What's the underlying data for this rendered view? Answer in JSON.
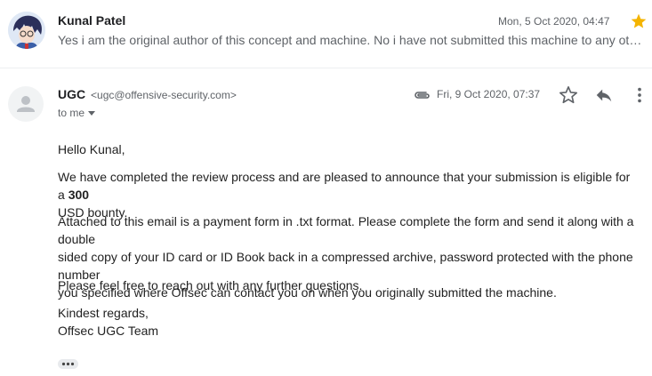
{
  "thread": {
    "collapsed_message": {
      "sender_name": "Kunal Patel",
      "date": "Mon, 5 Oct 2020, 04:47",
      "starred": true,
      "snippet": "Yes i am the original author of this concept and machine. No i have not submitted this machine to any other h..."
    },
    "expanded_message": {
      "sender_name": "UGC",
      "sender_email": "<ugc@offensive-security.com>",
      "to_label": "to me",
      "date": "Fri, 9 Oct 2020, 07:37",
      "has_attachment": true,
      "body": {
        "greeting": "Hello Kunal,",
        "para1_before": "We have completed the review process and are pleased to announce that your submission is eligible for a ",
        "para1_bold": "300",
        "para1_line2": "USD bounty.",
        "para2_line1": "Attached to this email is a payment form in .txt format. Please complete the form and send it along with a double",
        "para2_line2": "sided copy of your ID card or ID Book back in a compressed archive, password protected with the phone number",
        "para2_line3": "you specified where Offsec can contact you on when you originally submitted the machine.",
        "para3": "Please feel free to reach out with any further questions.",
        "closing_line1": "Kindest regards,",
        "closing_line2": "Offsec UGC Team"
      }
    }
  },
  "icons": {
    "star_filled_color": "#f4b400",
    "icon_gray": "#5f6368"
  }
}
